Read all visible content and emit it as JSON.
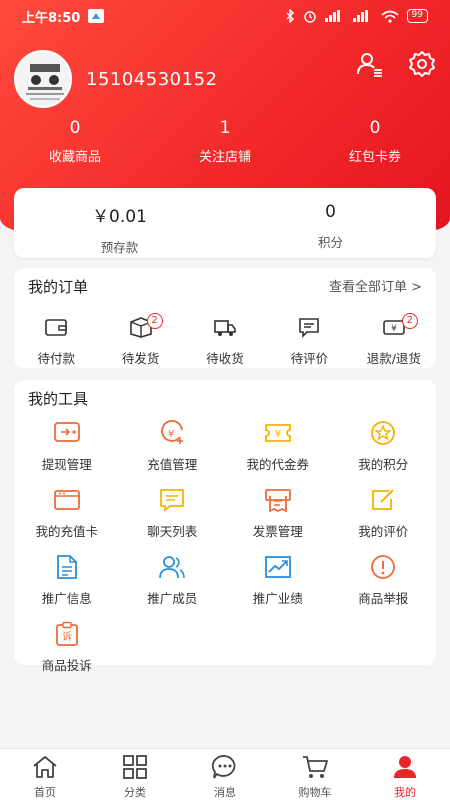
{
  "status_bar": {
    "time": "上午8:50",
    "battery": "99"
  },
  "profile": {
    "phone": "15104530152"
  },
  "stats": [
    {
      "value": "0",
      "label": "收藏商品"
    },
    {
      "value": "1",
      "label": "关注店铺"
    },
    {
      "value": "0",
      "label": "红包卡券"
    }
  ],
  "wallet": [
    {
      "value": "￥0.01",
      "label": "预存款"
    },
    {
      "value": "0",
      "label": "积分"
    }
  ],
  "orders": {
    "title": "我的订单",
    "view_all": "查看全部订单 >",
    "items": [
      {
        "label": "待付款",
        "icon": "wallet-icon",
        "badge": ""
      },
      {
        "label": "待发货",
        "icon": "package-icon",
        "badge": "2"
      },
      {
        "label": "待收货",
        "icon": "truck-icon",
        "badge": ""
      },
      {
        "label": "待评价",
        "icon": "comment-icon",
        "badge": ""
      },
      {
        "label": "退款/退货",
        "icon": "refund-icon",
        "badge": "2"
      }
    ]
  },
  "tools": {
    "title": "我的工具",
    "items": [
      {
        "label": "提现管理",
        "icon": "withdraw-icon",
        "color": "#f06a3a"
      },
      {
        "label": "充值管理",
        "icon": "recharge-icon",
        "color": "#f06a3a"
      },
      {
        "label": "我的代金券",
        "icon": "voucher-icon",
        "color": "#f5b400"
      },
      {
        "label": "我的积分",
        "icon": "points-icon",
        "color": "#f5b400"
      },
      {
        "label": "我的充值卡",
        "icon": "card-icon",
        "color": "#f06a3a"
      },
      {
        "label": "聊天列表",
        "icon": "chat-icon",
        "color": "#f5b400"
      },
      {
        "label": "发票管理",
        "icon": "invoice-icon",
        "color": "#f06a3a"
      },
      {
        "label": "我的评价",
        "icon": "review-icon",
        "color": "#f5b400"
      },
      {
        "label": "推广信息",
        "icon": "doc-icon",
        "color": "#2a8ee0"
      },
      {
        "label": "推广成员",
        "icon": "members-icon",
        "color": "#2a8ee0"
      },
      {
        "label": "推广业绩",
        "icon": "chart-icon",
        "color": "#2a8ee0"
      },
      {
        "label": "商品举报",
        "icon": "alert-icon",
        "color": "#f06a3a"
      },
      {
        "label": "商品投诉",
        "icon": "complaint-icon",
        "color": "#f06a3a"
      }
    ]
  },
  "tabbar": [
    {
      "label": "首页",
      "icon": "home-icon"
    },
    {
      "label": "分类",
      "icon": "grid-icon"
    },
    {
      "label": "消息",
      "icon": "message-icon"
    },
    {
      "label": "购物车",
      "icon": "cart-icon"
    },
    {
      "label": "我的",
      "icon": "user-icon",
      "active": true
    }
  ],
  "colors": {
    "brand": "#e8262b",
    "orange": "#f06a3a",
    "yellow": "#f5b400",
    "blue": "#2a8ee0"
  }
}
